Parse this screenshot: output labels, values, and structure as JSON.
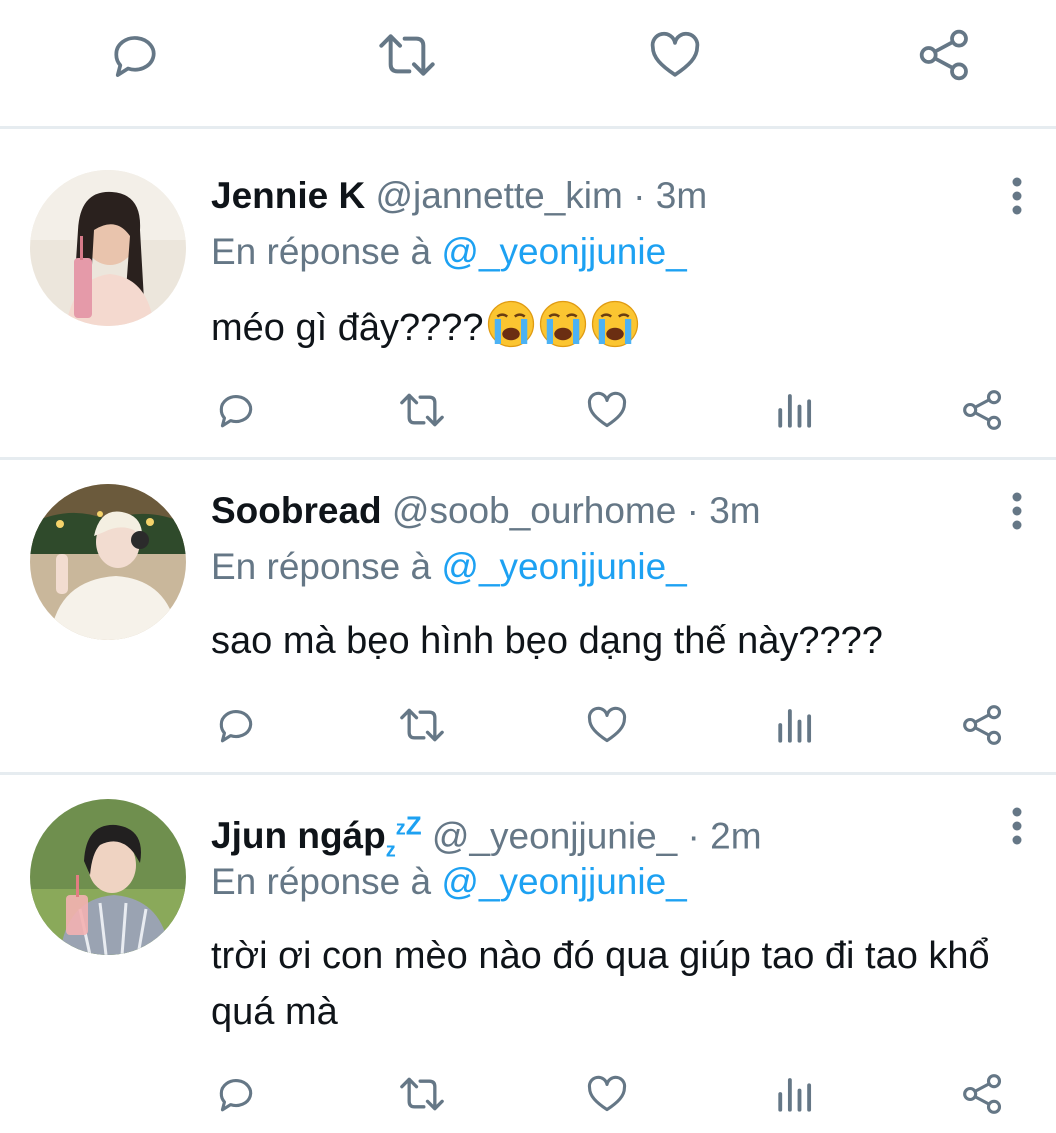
{
  "top_actions": [
    "reply-icon",
    "retweet-icon",
    "like-icon",
    "share-icon"
  ],
  "colors": {
    "icon": "#657786",
    "link": "#1da1f2",
    "text": "#0f1419",
    "divider": "#e6ecf0"
  },
  "tweets": [
    {
      "name": "Jennie K",
      "handle": "@jannette_kim",
      "dot": "·",
      "time": "3m",
      "reply_prefix": "En réponse à",
      "reply_to": "@_yeonjjunie_",
      "text": "méo gì đây????",
      "emojis": [
        "loudly-crying-face",
        "loudly-crying-face",
        "loudly-crying-face"
      ]
    },
    {
      "name": "Soobread",
      "handle": "@soob_ourhome",
      "dot": "·",
      "time": "3m",
      "reply_prefix": "En réponse à",
      "reply_to": "@_yeonjjunie_",
      "text": "sao mà bẹo hình bẹo dạng thế này????"
    },
    {
      "name": "Jjun ngáp",
      "name_sub": "z",
      "name_sup1": "z",
      "name_sup2": "Z",
      "handle": "@_yeonjjunie_",
      "dot": "·",
      "time": "2m",
      "reply_prefix": "En réponse à",
      "reply_to": "@_yeonjjunie_",
      "text": "trời ơi con mèo nào đó qua giúp tao đi tao khổ quá mà"
    }
  ]
}
